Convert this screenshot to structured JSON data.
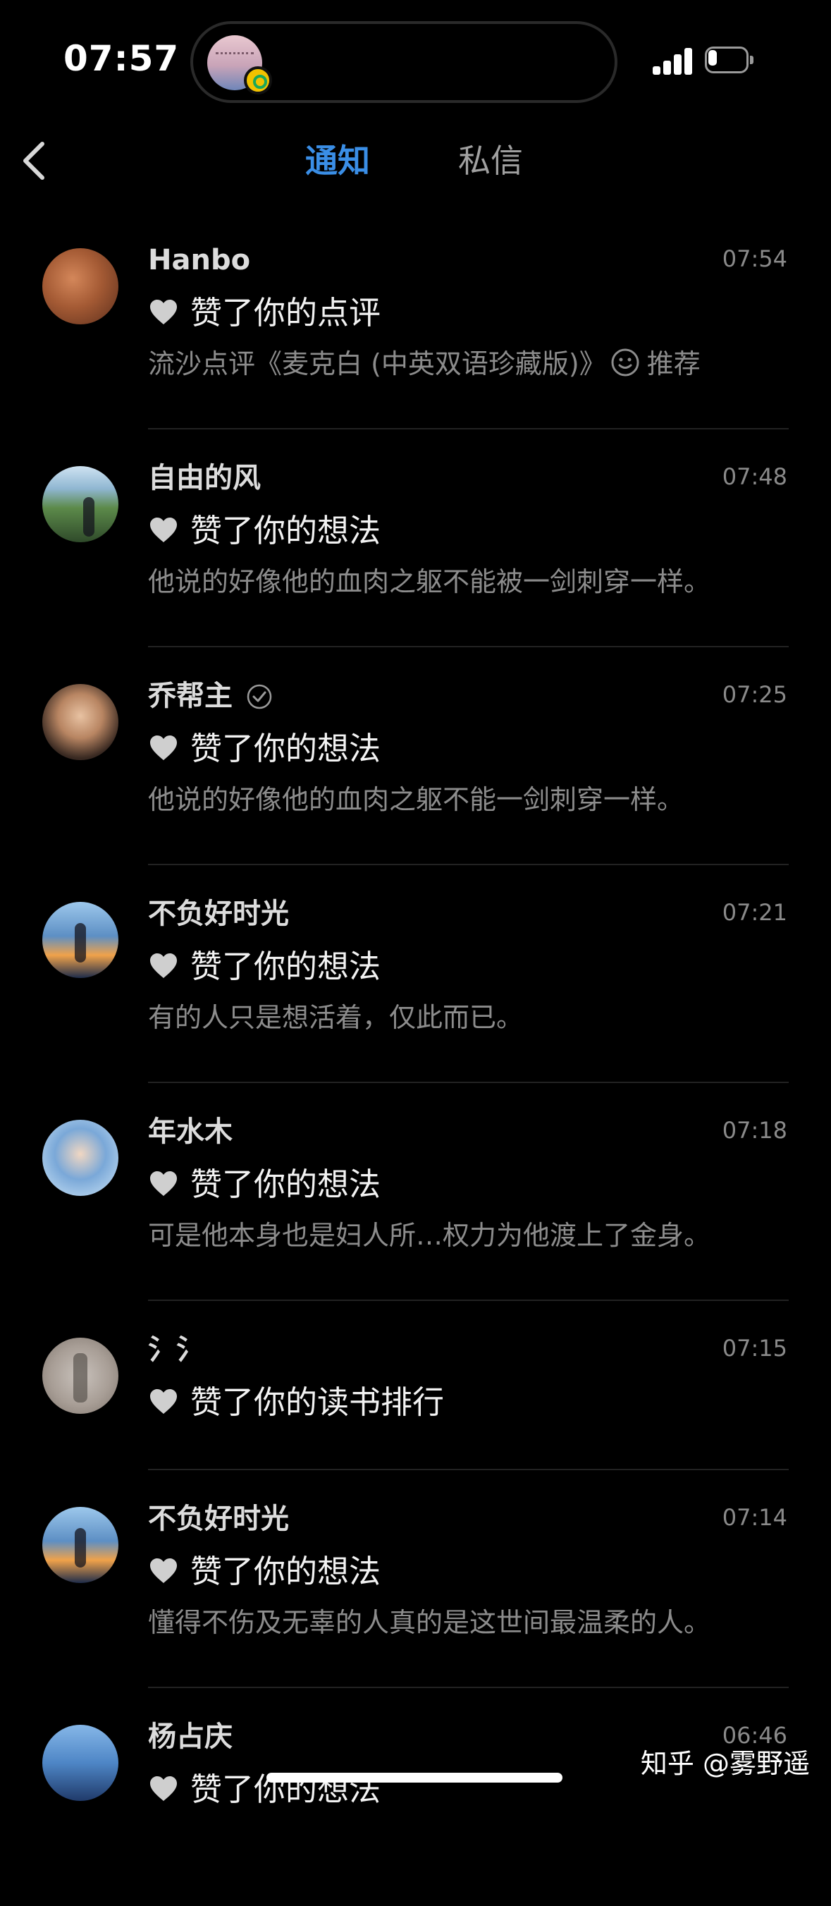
{
  "status_bar": {
    "time": "07:57"
  },
  "nav": {
    "tabs": [
      {
        "label": "通知",
        "active": true
      },
      {
        "label": "私信",
        "active": false
      }
    ]
  },
  "colors": {
    "background": "#000000",
    "active_tab": "#3a8ee6",
    "inactive_tab": "#a0a0a0",
    "secondary_text": "#8c8c8c"
  },
  "notifications": [
    {
      "username": "Hanbo",
      "time": "07:54",
      "action": "赞了你的点评",
      "content": "流沙点评《麦克白 (中英双语珍藏版)》",
      "content_suffix": "推荐",
      "content_icon": "smile-icon"
    },
    {
      "username": "自由的风",
      "time": "07:48",
      "action": "赞了你的想法",
      "content": "他说的好像他的血肉之躯不能被一剑刺穿一样。"
    },
    {
      "username": "乔帮主",
      "verified": true,
      "time": "07:25",
      "action": "赞了你的想法",
      "content": "他说的好像他的血肉之躯不能一剑刺穿一样。"
    },
    {
      "username": "不负好时光",
      "time": "07:21",
      "action": "赞了你的想法",
      "content": "有的人只是想活着，仅此而已。"
    },
    {
      "username": "年水木",
      "time": "07:18",
      "action": "赞了你的想法",
      "content": "可是他本身也是妇人所…权力为他渡上了金身。"
    },
    {
      "username": "氵氵",
      "time": "07:15",
      "action": "赞了你的读书排行"
    },
    {
      "username": "不负好时光",
      "time": "07:14",
      "action": "赞了你的想法",
      "content": "懂得不伤及无辜的人真的是这世间最温柔的人。"
    },
    {
      "username": "杨占庆",
      "time": "06:46",
      "action": "赞了你的想法"
    }
  ],
  "watermark": "知乎 @雾野遥"
}
